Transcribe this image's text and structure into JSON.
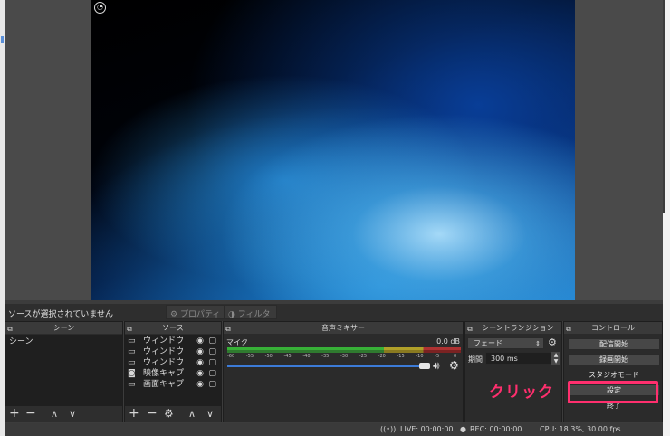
{
  "preview": {
    "logo_icon": "obs-logo-icon"
  },
  "source_bar": {
    "no_source": "ソースが選択されていません",
    "properties": "プロパティ",
    "filters": "フィルタ"
  },
  "scenes": {
    "title": "シーン",
    "items": [
      "シーン"
    ]
  },
  "sources": {
    "title": "ソース",
    "items": [
      {
        "icon": "window-icon",
        "name": "ウィンドウ"
      },
      {
        "icon": "window-icon",
        "name": "ウィンドウ"
      },
      {
        "icon": "window-icon",
        "name": "ウィンドウ"
      },
      {
        "icon": "camera-icon",
        "name": "映像キャプ"
      },
      {
        "icon": "monitor-icon",
        "name": "画面キャプ"
      }
    ]
  },
  "mixer": {
    "title": "音声ミキサー",
    "channel": "マイク",
    "level": "0.0 dB",
    "ticks": [
      "-60",
      "-55",
      "-50",
      "-45",
      "-40",
      "-35",
      "-30",
      "-25",
      "-20",
      "-15",
      "-10",
      "-5",
      "0"
    ]
  },
  "transition": {
    "title": "シーントランジション",
    "type": "フェード",
    "duration_label": "期間",
    "duration": "300 ms"
  },
  "controls": {
    "title": "コントロール",
    "start_streaming": "配信開始",
    "start_recording": "録画開始",
    "studio_mode": "スタジオモード",
    "settings": "設定",
    "exit": "終了"
  },
  "annotation": {
    "click": "クリック",
    "color": "#ff2f6e"
  },
  "status": {
    "live": "LIVE: 00:00:00",
    "rec": "REC: 00:00:00",
    "cpu": "CPU: 18.3%, 30.00 fps"
  }
}
